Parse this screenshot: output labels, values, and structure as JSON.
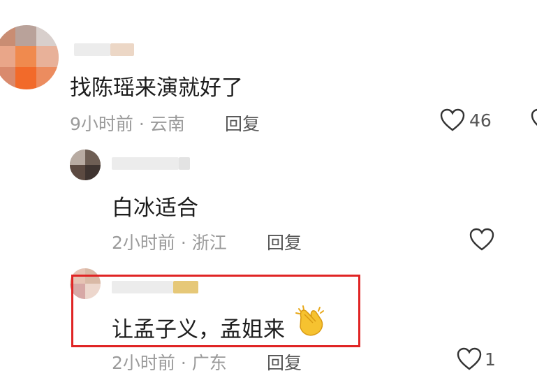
{
  "comments": [
    {
      "text": "找陈瑶来演就好了",
      "time": "9小时前",
      "location": "云南",
      "reply_label": "回复",
      "likes": "46"
    },
    {
      "text": "白冰适合",
      "time": "2小时前",
      "location": "浙江",
      "reply_label": "回复",
      "likes": ""
    },
    {
      "text": "让孟子义，孟姐来",
      "time": "2小时前",
      "location": "广东",
      "reply_label": "回复",
      "likes": "1",
      "emoji": "clapping-hands-icon"
    }
  ],
  "separator": "·",
  "colors": {
    "highlight_border": "#e02424",
    "meta_text": "#9a9a9a"
  }
}
